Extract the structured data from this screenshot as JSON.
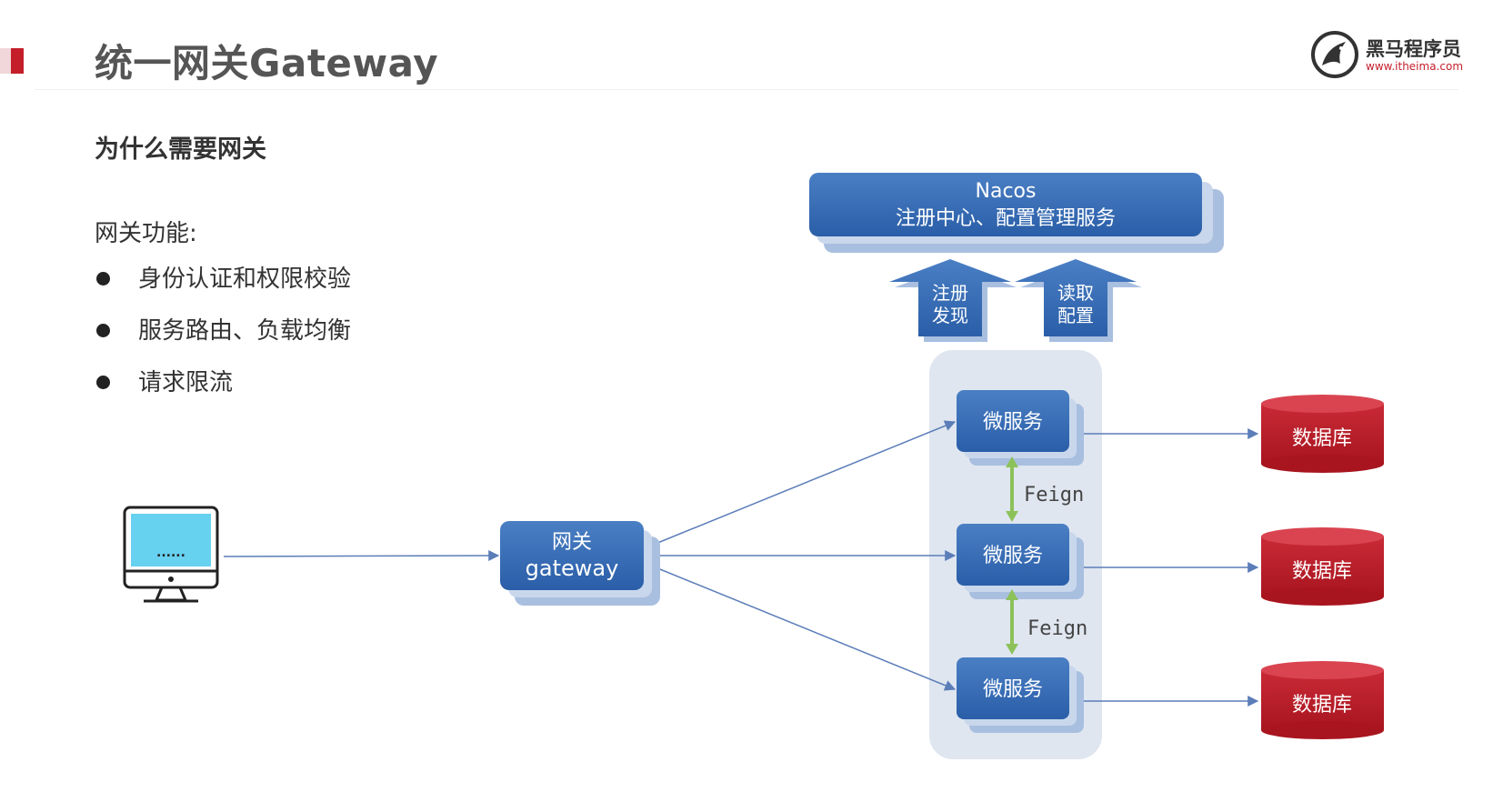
{
  "header": {
    "title": "统一网关Gateway",
    "logo_name": "黑马程序员",
    "logo_url": "www.itheima.com",
    "accent_color": "#c41e2b"
  },
  "content": {
    "heading": "为什么需要网关",
    "features_title": "网关功能:",
    "features": [
      "身份认证和权限校验",
      "服务路由、负载均衡",
      "请求限流"
    ]
  },
  "diagram": {
    "nacos": {
      "line1": "Nacos",
      "line2": "注册中心、配置管理服务"
    },
    "arrows_up": [
      {
        "line1": "注册",
        "line2": "发现"
      },
      {
        "line1": "读取",
        "line2": "配置"
      }
    ],
    "client_screen_text": "......",
    "gateway": {
      "line1": "网关",
      "line2": "gateway"
    },
    "microservices": [
      "微服务",
      "微服务",
      "微服务"
    ],
    "feign_labels": [
      "Feign",
      "Feign"
    ],
    "databases": [
      "数据库",
      "数据库",
      "数据库"
    ],
    "colors": {
      "box_blue": "#3a6fb6",
      "box_blue_dark": "#2a5ea8",
      "shadow_blue": "#a9bfe0",
      "db_red": "#c0202e",
      "feign_green": "#8dc15a",
      "group_bg": "#dfe6f0",
      "line": "#5b7db8"
    }
  }
}
